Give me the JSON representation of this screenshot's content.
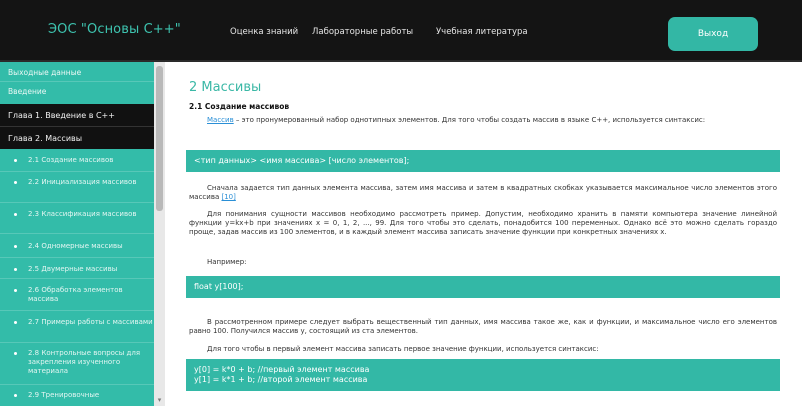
{
  "header": {
    "brand": "ЭОС \"Основы С++\"",
    "nav": [
      "Оценка знаний",
      "Лабораторные работы",
      "Учебная литература"
    ],
    "logout": "Выход"
  },
  "sidebar": {
    "items": [
      {
        "label": "Выходные данные"
      },
      {
        "label": "Введение"
      },
      {
        "label": "Глава 1. Введение в С++"
      },
      {
        "label": "Глава 2. Массивы"
      },
      {
        "label": "2.1 Создание массивов"
      },
      {
        "label": "2.2 Инициализация массивов"
      },
      {
        "label": "2.3 Классификация массивов"
      },
      {
        "label": "2.4 Одномерные массивы"
      },
      {
        "label": "2.5 Двумерные массивы"
      },
      {
        "label": "2.6 Обработка элементов массива"
      },
      {
        "label": "2.7 Примеры работы с массивами"
      },
      {
        "label": "2.8 Контрольные вопросы для закрепления изученного материала"
      },
      {
        "label": "2.9 Тренировочные"
      }
    ]
  },
  "main": {
    "title": "2 Массивы",
    "subtitle": "2.1 Создание массивов",
    "p1_link": "Массив",
    "p1": " – это пронумерованный набор однотипных элементов. Для того чтобы создать массив в языке С++, используется синтаксис:",
    "code1": "<тип данных> <имя массива> [число элементов];",
    "p2": "Сначала задается тип данных элемента массива, затем имя массива и затем в квадратных скобках указывается максимальное число элементов этого массива ",
    "p2_ref": "[10]",
    "p3": "Для понимания сущности массивов необходимо рассмотреть пример. Допустим, необходимо хранить в памяти компьютера значение линейной функции y=kx+b при значениях x = 0, 1, 2, ..., 99. Для того чтобы это сделать, понадобится 100 переменных. Однако всё это можно сделать гораздо проще, задав массив из 100 элементов, и в каждый элемент массива записать значение функции при конкретных значениях x.",
    "p4": "Например:",
    "code2": "float y[100];",
    "p5": "В рассмотренном примере следует выбрать вещественный тип данных, имя массива такое же, как и функции, и максимальное число его элементов равно 100. Получился массив y, состоящий из ста элементов.",
    "p6": "Для того чтобы в первый элемент массива записать первое значение функции, используется синтаксис:",
    "code3_line1": "y[0] = k*0 + b; //первый элемент массива",
    "code3_line2": "y[1] = k*1 + b; //второй элемент массива"
  }
}
